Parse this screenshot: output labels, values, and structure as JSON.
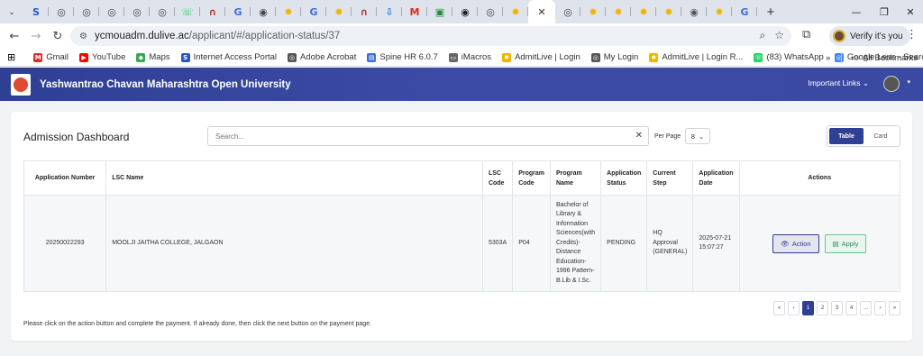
{
  "browser": {
    "url_host": "ycmouadm.dulive.ac",
    "url_path": "/applicant/#/application-status/37",
    "profile_label": "Verify it's you",
    "tabs": [
      {
        "icon": "S",
        "color": "#2557c7"
      },
      {
        "icon": "◎",
        "color": "#444444"
      },
      {
        "icon": "◎",
        "color": "#444444"
      },
      {
        "icon": "◎",
        "color": "#444444"
      },
      {
        "icon": "◎",
        "color": "#444444"
      },
      {
        "icon": "◎",
        "color": "#444444"
      },
      {
        "icon": "☏",
        "color": "#25d366"
      },
      {
        "icon": "∩",
        "color": "#c0392b"
      },
      {
        "icon": "G",
        "color": "#3a6fd8"
      },
      {
        "icon": "◉",
        "color": "#444444"
      },
      {
        "icon": "✹",
        "color": "#f0b400"
      },
      {
        "icon": "G",
        "color": "#3a6fd8"
      },
      {
        "icon": "✹",
        "color": "#f0b400"
      },
      {
        "icon": "∩",
        "color": "#c0392b"
      },
      {
        "icon": "⇩",
        "color": "#2a7de1"
      },
      {
        "icon": "M",
        "color": "#d93025"
      },
      {
        "icon": "▣",
        "color": "#1e8e3e"
      },
      {
        "icon": "◉",
        "color": "#222222"
      },
      {
        "icon": "◎",
        "color": "#444444"
      },
      {
        "icon": "✹",
        "color": "#f0b400"
      }
    ],
    "tabs_after": [
      {
        "icon": "◎",
        "color": "#444444"
      },
      {
        "icon": "✹",
        "color": "#f0b400"
      },
      {
        "icon": "✹",
        "color": "#f0b400"
      },
      {
        "icon": "✹",
        "color": "#f0b400"
      },
      {
        "icon": "✹",
        "color": "#f0b400"
      },
      {
        "icon": "◉",
        "color": "#555555"
      },
      {
        "icon": "✹",
        "color": "#f0b400"
      },
      {
        "icon": "G",
        "color": "#3a6fd8"
      }
    ],
    "bookmarks": [
      {
        "label": "Gmail",
        "icon": "M",
        "color": "#d93025"
      },
      {
        "label": "YouTube",
        "icon": "▶",
        "color": "#ff0000"
      },
      {
        "label": "Maps",
        "icon": "◆",
        "color": "#34a853"
      },
      {
        "label": "Internet Access Portal",
        "icon": "S",
        "color": "#2557c7"
      },
      {
        "label": "Adobe Acrobat",
        "icon": "◎",
        "color": "#555555"
      },
      {
        "label": "Spine HR 6.0.7",
        "icon": "▤",
        "color": "#3a6fd8"
      },
      {
        "label": "iMacros",
        "icon": "▭",
        "color": "#666666"
      },
      {
        "label": "AdmitLive | Login",
        "icon": "✹",
        "color": "#f0b400"
      },
      {
        "label": "My Login",
        "icon": "◎",
        "color": "#555555"
      },
      {
        "label": "AdmitLive | Login R...",
        "icon": "✹",
        "color": "#f0b400"
      },
      {
        "label": "(83) WhatsApp",
        "icon": "☏",
        "color": "#25d366"
      },
      {
        "label": "Google Lens - Searc...",
        "icon": "◎",
        "color": "#4285f4"
      }
    ],
    "all_bookmarks": "All Bookmarks"
  },
  "app": {
    "university_name": "Yashwantrao Chavan Maharashtra Open University",
    "important_links": "Important Links",
    "accent_color": "#2f3f94"
  },
  "dashboard": {
    "title": "Admission Dashboard",
    "search_placeholder": "Search...",
    "per_page_label": "Per Page",
    "per_page_value": "8",
    "view_table": "Table",
    "view_card": "Card",
    "columns": [
      "Application Number",
      "LSC Name",
      "LSC Code",
      "Program Code",
      "Program Name",
      "Application Status",
      "Current Step",
      "Application Date",
      "Actions"
    ],
    "rows": [
      {
        "application_number": "20250022293",
        "lsc_name": "MOOLJI JAITHA COLLEGE, JALGAON",
        "lsc_code": "5303A",
        "program_code": "P04",
        "program_name": "Bachelor of Library & Information Sciences(with Credits)-Distance Education-1996 Pattern-B.Lib & I.Sc.",
        "status": "PENDING",
        "current_step": "HQ Approval (GENERAL)",
        "application_date": "2025-07-21 15:07:27",
        "action_label": "Action",
        "apply_label": "Apply"
      }
    ],
    "pagination": [
      "«",
      "‹",
      "1",
      "2",
      "3",
      "4",
      "...",
      "›",
      "»"
    ],
    "current_page": "1",
    "footnote": "Please click on the action button and complete the payment. If already done, then click the next button on the payment page."
  }
}
